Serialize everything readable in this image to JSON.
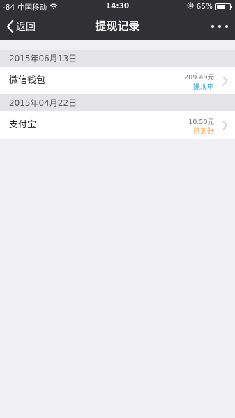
{
  "status_bar": {
    "signal": "-84",
    "carrier": "中国移动",
    "wifi_icon": "wifi-icon",
    "time": "14:30",
    "orientation_lock_icon": "orientation-lock-icon",
    "battery_percent": "65%",
    "battery_level": 0.65
  },
  "navbar": {
    "back_label": "返回",
    "title": "提现记录",
    "more_icon": "more-icon"
  },
  "sections": [
    {
      "date": "2015年06月13日",
      "item": {
        "name": "微信钱包",
        "amount": "209.49元",
        "status": "提现中",
        "status_color": "#2f9de5"
      }
    },
    {
      "date": "2015年04月22日",
      "item": {
        "name": "支付宝",
        "amount": "10.50元",
        "status": "已到账",
        "status_color": "#f39b35"
      }
    }
  ],
  "colors": {
    "header_bg": "#303035",
    "page_bg": "#efeff4",
    "section_bg": "#e3e3e8"
  }
}
